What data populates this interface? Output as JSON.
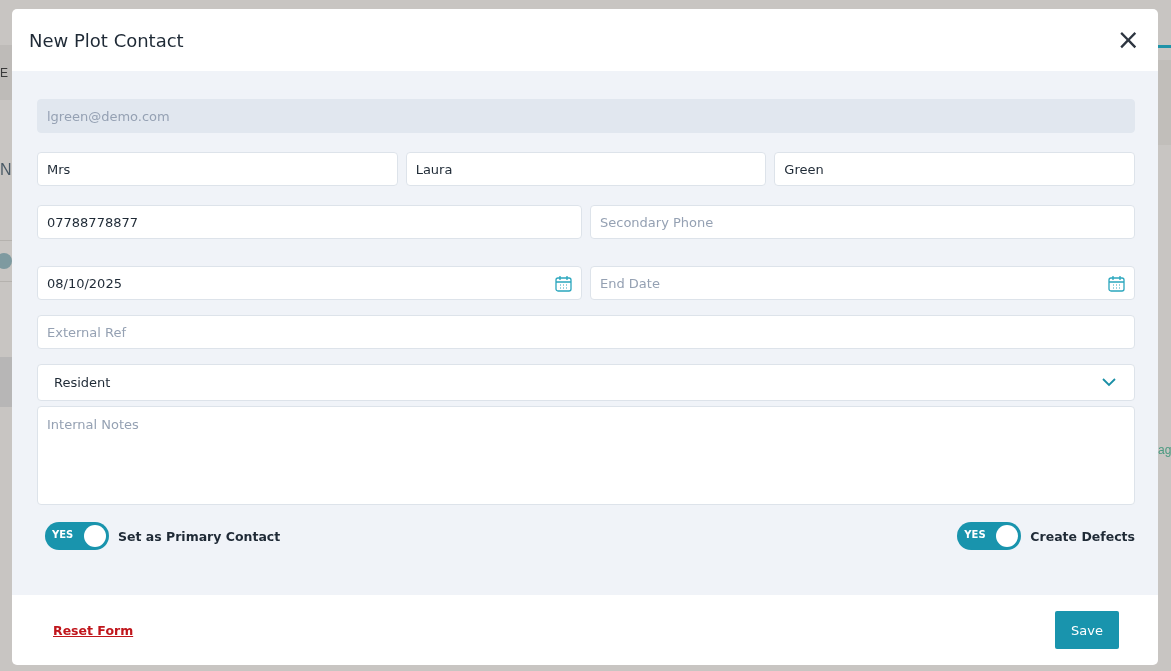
{
  "backdrop": {
    "left_texts": [
      "E",
      "N"
    ],
    "right_text": "ag"
  },
  "dialog": {
    "title": "New Plot Contact",
    "close": "×"
  },
  "form": {
    "email": {
      "value": "lgreen@demo.com",
      "disabled": true
    },
    "name_fields": [
      {
        "value": "Mrs"
      },
      {
        "value": "Laura"
      },
      {
        "value": "Green"
      }
    ],
    "phone_fields": [
      {
        "value": "07788778877"
      },
      {
        "placeholder": "Secondary Phone"
      }
    ],
    "date_fields": [
      {
        "value": "08/10/2025"
      },
      {
        "placeholder": "End Date"
      }
    ],
    "external_ref": {
      "placeholder": "External Ref"
    },
    "contact_type": {
      "value": "Resident"
    },
    "internal_notes": {
      "placeholder": "Internal Notes"
    },
    "toggles": [
      {
        "label": "Set as Primary Contact",
        "on": true,
        "on_text": "YES"
      },
      {
        "label": "Create Defects",
        "on": true,
        "on_text": "YES"
      }
    ]
  },
  "footer": {
    "reset": "Reset Form",
    "save": "Save"
  }
}
